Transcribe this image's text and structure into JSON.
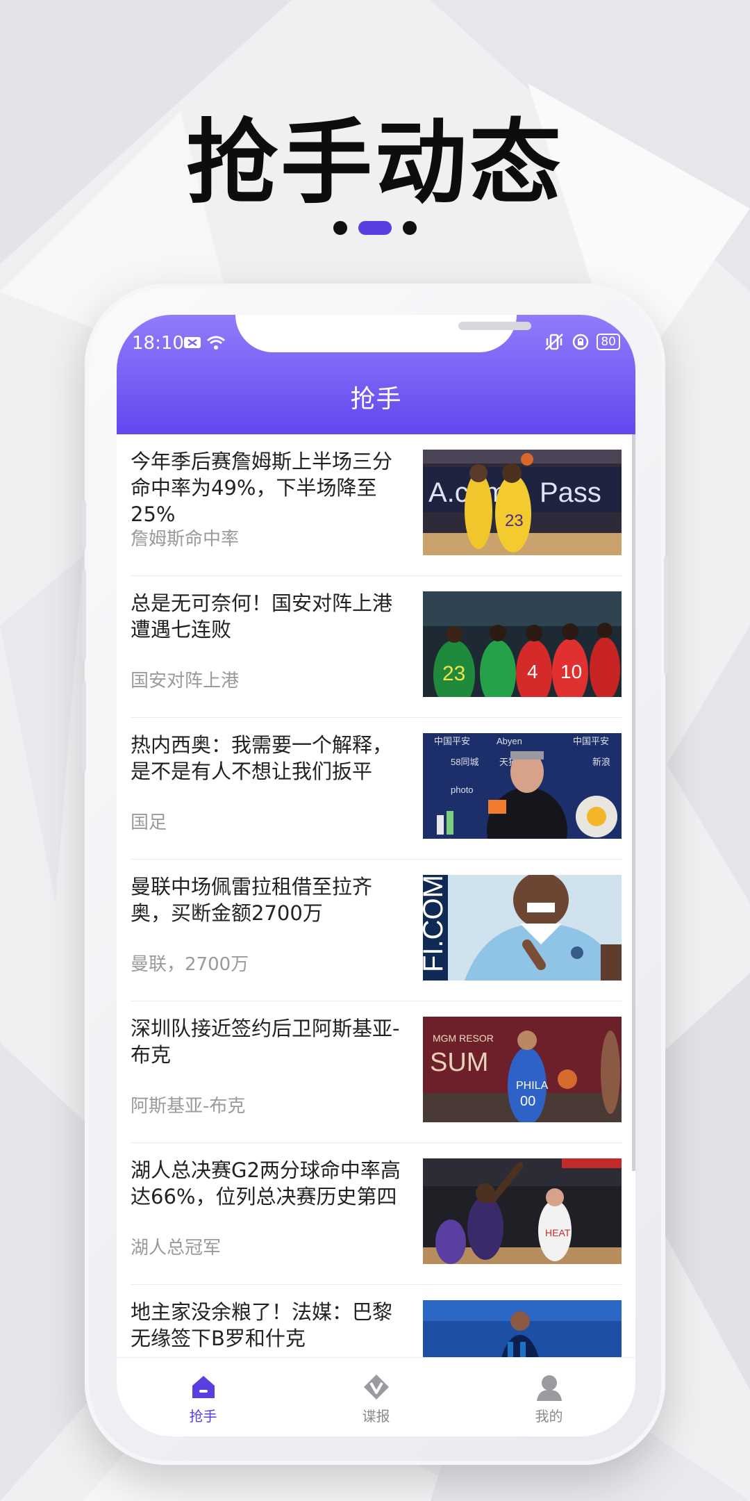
{
  "promo": {
    "headline": "抢手动态",
    "accent": "#5a3fe0"
  },
  "status_bar": {
    "time": "18:10",
    "battery": "80"
  },
  "app": {
    "title": "抢手"
  },
  "news": [
    {
      "title": "今年季后赛詹姆斯上半场三分命中率为49%，下半场降至25%",
      "tag": "詹姆斯命中率",
      "image": "basketball-players-photo"
    },
    {
      "title": "总是无可奈何！国安对阵上港遭遇七连败",
      "tag": "国安对阵上港",
      "image": "football-players-photo"
    },
    {
      "title": "热内西奥：我需要一个解释，是不是有人不想让我们扳平",
      "tag": "国足",
      "image": "press-conference-photo"
    },
    {
      "title": "曼联中场佩雷拉租借至拉齐奥，买断金额2700万",
      "tag": "曼联，2700万",
      "image": "player-jersey-photo"
    },
    {
      "title": "深圳队接近签约后卫阿斯基亚-布克",
      "tag": "阿斯基亚-布克",
      "image": "basketball-player-photo"
    },
    {
      "title": "湖人总决赛G2两分球命中率高达66%，位列总决赛历史第四",
      "tag": "湖人总冠军",
      "image": "basketball-dunk-photo"
    },
    {
      "title": "地主家没余粮了！法媒：巴黎无缘签下B罗和什克",
      "tag": "",
      "image": "soccer-player-photo"
    }
  ],
  "bottom_nav": [
    {
      "label": "抢手",
      "icon": "home-icon",
      "active": true
    },
    {
      "label": "谍报",
      "icon": "v-diamond-icon",
      "active": false
    },
    {
      "label": "我的",
      "icon": "user-icon",
      "active": false
    }
  ]
}
